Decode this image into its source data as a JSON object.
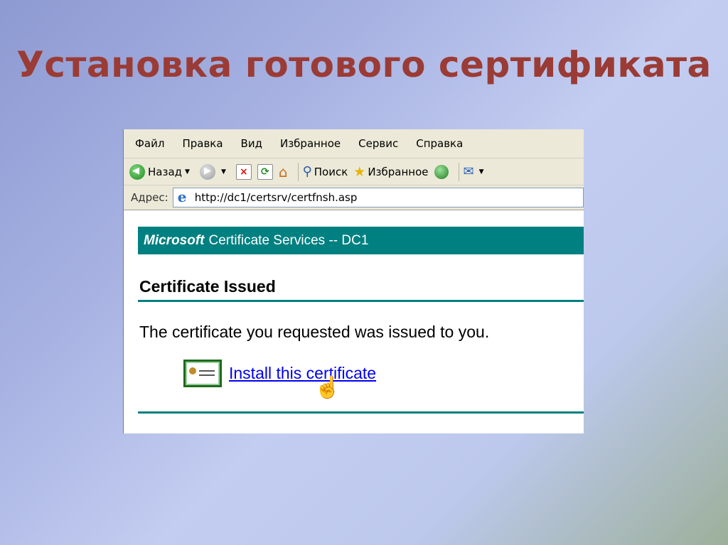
{
  "slide": {
    "title": "Установка готового сертификата"
  },
  "menu": {
    "items": [
      "Файл",
      "Правка",
      "Вид",
      "Избранное",
      "Сервис",
      "Справка"
    ]
  },
  "toolbar": {
    "back_label": "Назад",
    "search_label": "Поиск",
    "favorites_label": "Избранное"
  },
  "address": {
    "label": "Адрес:",
    "url": "http://dc1/certsrv/certfnsh.asp"
  },
  "page": {
    "banner_brand": "Microsoft",
    "banner_text": "Certificate Services  --  DC1",
    "heading": "Certificate Issued",
    "message": "The certificate you requested was issued to you.",
    "install_link": "Install this certificate"
  },
  "colors": {
    "title": "#9b3b35",
    "banner": "#008080",
    "link": "#0000ee"
  }
}
